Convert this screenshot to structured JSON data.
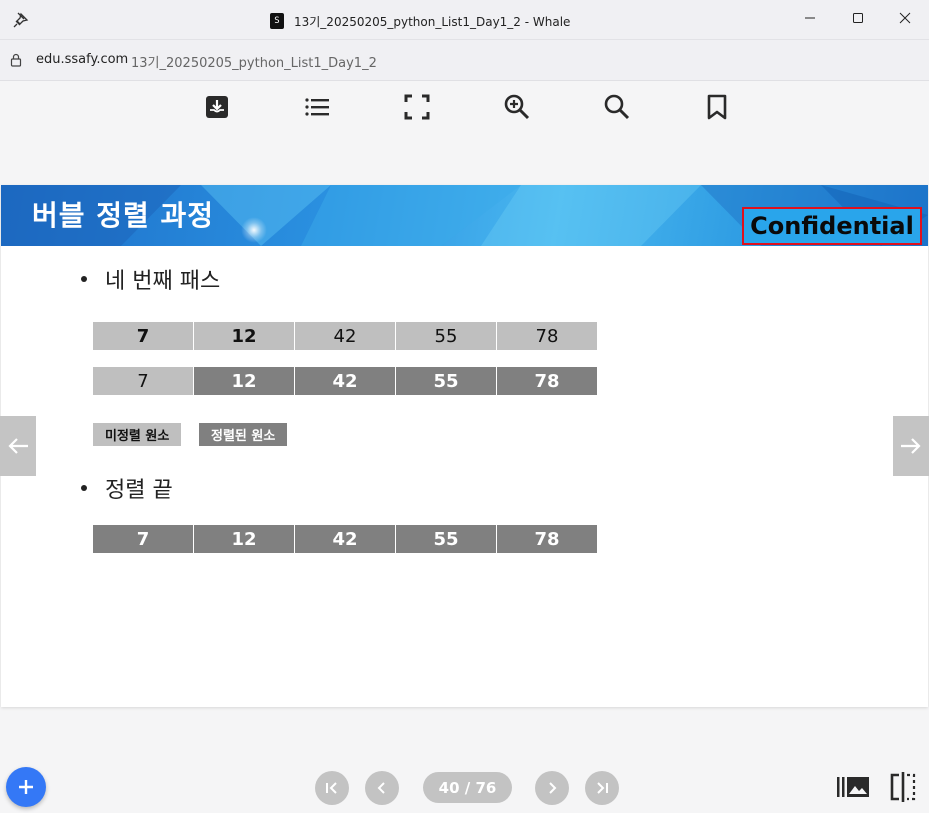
{
  "window": {
    "title": "13기_20250205_python_List1_Day1_2 - Whale",
    "favicon_text": "S",
    "controls": [
      "minimize-icon",
      "maximize-icon",
      "close-icon"
    ]
  },
  "address": {
    "domain": "edu.ssafy.com",
    "page_title": "13기_20250205_python_List1_Day1_2"
  },
  "toolbar": {
    "icons": [
      "download-icon",
      "list-icon",
      "fullscreen-icon",
      "zoom-in-icon",
      "search-icon",
      "bookmark-icon"
    ]
  },
  "slide": {
    "title": "버블 정렬 과정",
    "confidential": "Confidential",
    "bullet1": "네 번째 패스",
    "row1": [
      "7",
      "12",
      "42",
      "55",
      "78"
    ],
    "row2": [
      "7",
      "12",
      "42",
      "55",
      "78"
    ],
    "legend_unsorted": "미정렬 원소",
    "legend_sorted": "정렬된 원소",
    "bullet2": "정렬 끝",
    "row3": [
      "7",
      "12",
      "42",
      "55",
      "78"
    ],
    "colors": {
      "unsorted": "#bfbfbf",
      "sorted": "#808080",
      "banner": "#2a90e0",
      "highlight_border": "#e0101d"
    }
  },
  "pager": {
    "page_label": "40 / 76",
    "current": 40,
    "total": 76
  }
}
